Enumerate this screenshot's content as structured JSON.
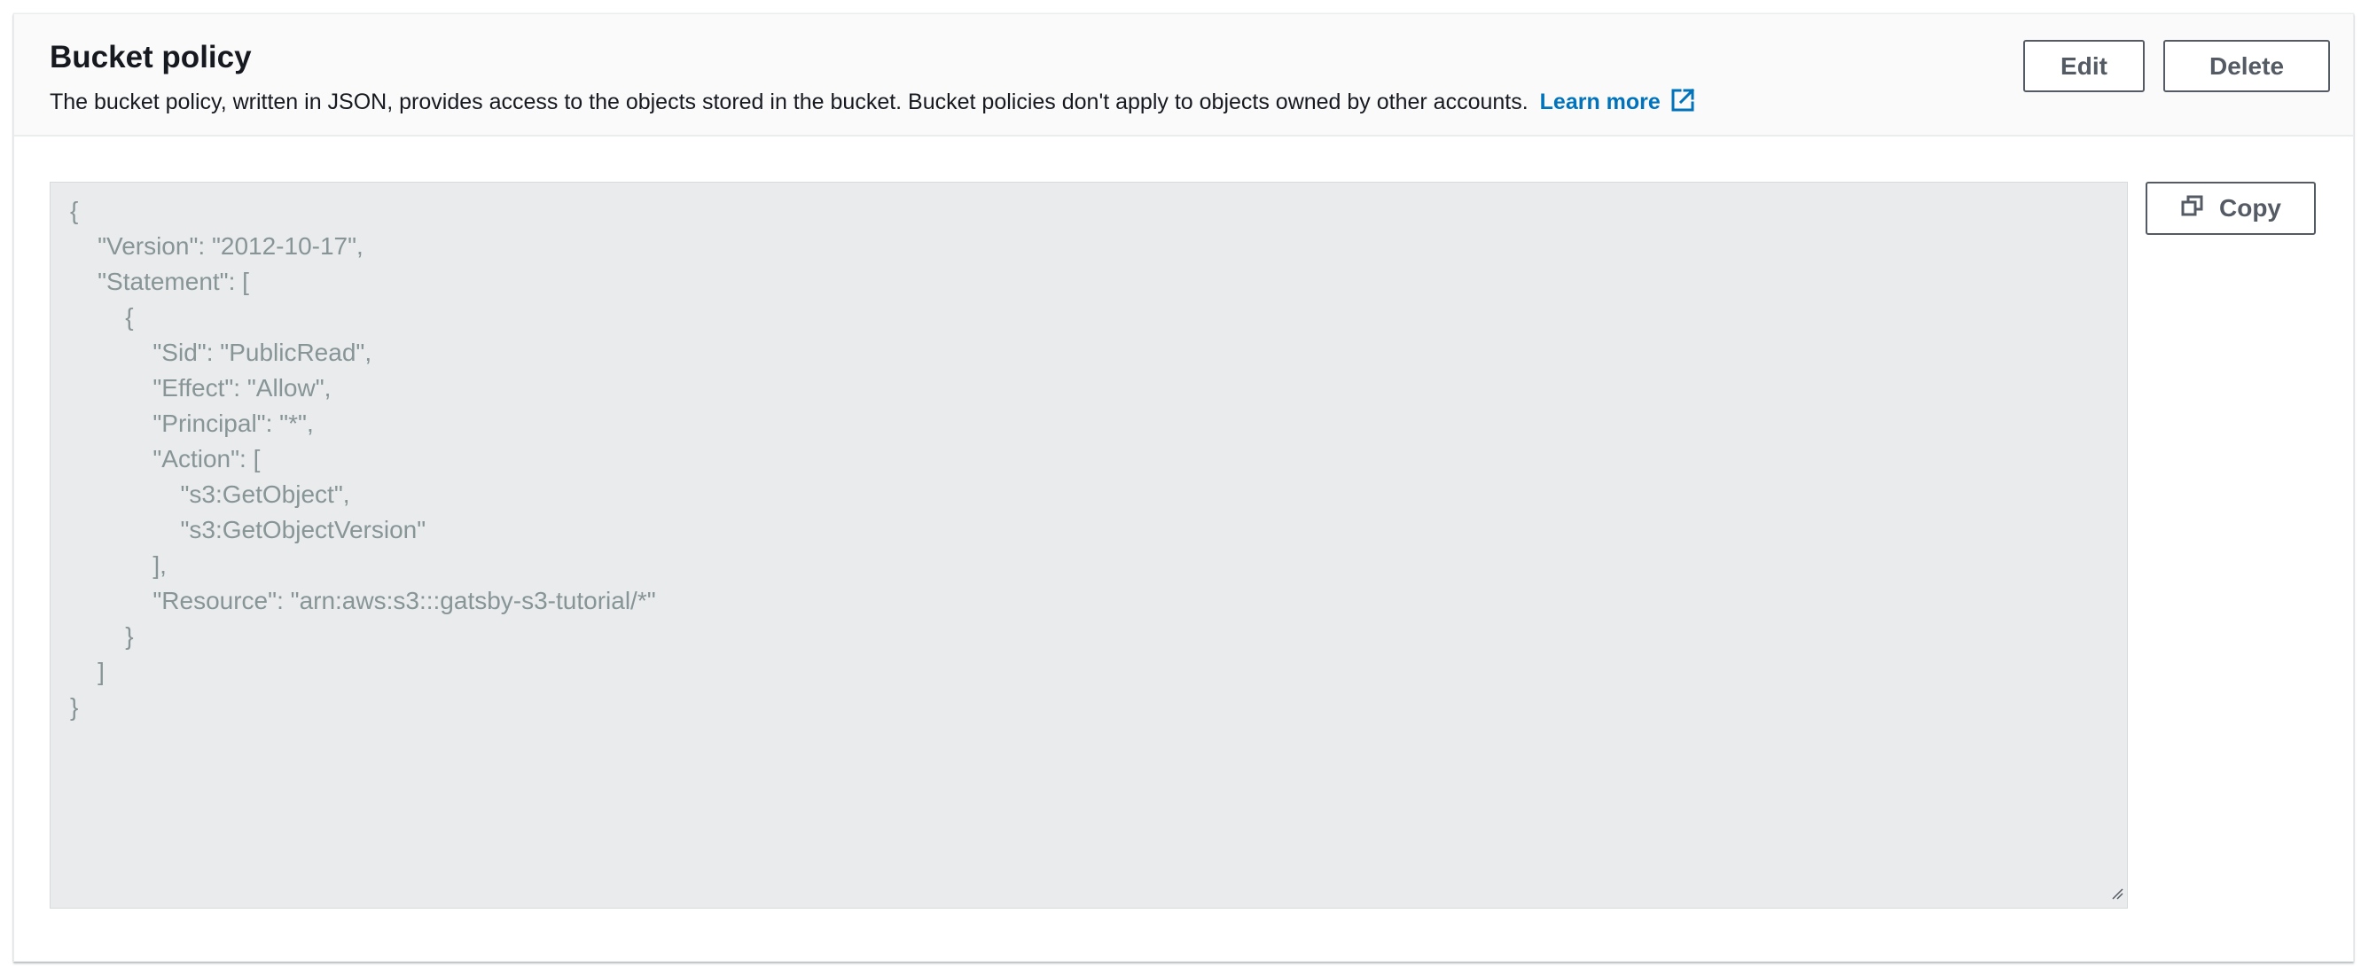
{
  "header": {
    "title": "Bucket policy",
    "description": "The bucket policy, written in JSON, provides access to the objects stored in the bucket. Bucket policies don't apply to objects owned by other accounts.",
    "learn_more": "Learn more",
    "external_link_icon": "external-link-icon"
  },
  "actions": {
    "edit_label": "Edit",
    "delete_label": "Delete",
    "copy_label": "Copy",
    "copy_icon": "copy-icon"
  },
  "policy_editor": {
    "lines": [
      "{",
      "    \"Version\": \"2012-10-17\",",
      "    \"Statement\": [",
      "        {",
      "            \"Sid\": \"PublicRead\",",
      "            \"Effect\": \"Allow\",",
      "            \"Principal\": \"*\",",
      "            \"Action\": [",
      "                \"s3:GetObject\",",
      "                \"s3:GetObjectVersion\"",
      "            ],",
      "            \"Resource\": \"arn:aws:s3:::gatsby-s3-tutorial/*\"",
      "        }",
      "    ]",
      "}"
    ]
  },
  "colors": {
    "link": "#0073bb",
    "button_border": "#545b64",
    "editor_bg": "#e9ebed",
    "code_text": "#879596"
  }
}
